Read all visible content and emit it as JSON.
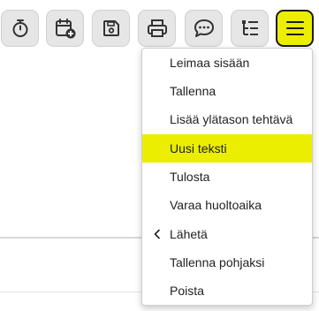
{
  "toolbar": {
    "buttons": [
      {
        "icon": "stopwatch-icon"
      },
      {
        "icon": "calendar-add-icon"
      },
      {
        "icon": "save-icon"
      },
      {
        "icon": "print-icon"
      },
      {
        "icon": "chat-icon"
      },
      {
        "icon": "task-tree-icon"
      },
      {
        "icon": "hamburger-menu-icon",
        "active": true
      }
    ],
    "accent_color": "#ebee00"
  },
  "menu": {
    "items": [
      {
        "label": "Leimaa sisään"
      },
      {
        "label": "Tallenna"
      },
      {
        "label": "Lisää ylätason tehtävä"
      },
      {
        "label": "Uusi teksti",
        "highlighted": true
      },
      {
        "label": "Tulosta"
      },
      {
        "label": "Varaa huoltoaika"
      },
      {
        "label": "Lähetä",
        "has_submenu": true,
        "submenu_icon": "chevron-left-icon"
      },
      {
        "label": "Tallenna pohjaksi"
      },
      {
        "label": "Poista"
      }
    ]
  }
}
